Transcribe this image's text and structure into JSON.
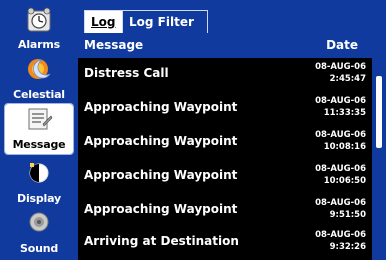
{
  "sidebar": {
    "items": [
      {
        "label": "Alarms",
        "icon": "alarm-clock-icon",
        "selected": false
      },
      {
        "label": "Celestial",
        "icon": "sun-moon-icon",
        "selected": false
      },
      {
        "label": "Message",
        "icon": "message-log-icon",
        "selected": true
      },
      {
        "label": "Display",
        "icon": "display-contrast-icon",
        "selected": false
      },
      {
        "label": "Sound",
        "icon": "speaker-icon",
        "selected": false
      }
    ]
  },
  "tabs": [
    {
      "label": "Log",
      "active": true
    },
    {
      "label": "Log Filter",
      "active": false
    }
  ],
  "table": {
    "columns": {
      "message": "Message",
      "date": "Date"
    },
    "rows": [
      {
        "message": "Distress Call",
        "date": "08-AUG-06",
        "time": "2:45:47"
      },
      {
        "message": "Approaching Waypoint",
        "date": "08-AUG-06",
        "time": "11:33:35"
      },
      {
        "message": "Approaching Waypoint",
        "date": "08-AUG-06",
        "time": "10:08:16"
      },
      {
        "message": "Approaching Waypoint",
        "date": "08-AUG-06",
        "time": "10:06:50"
      },
      {
        "message": "Approaching Waypoint",
        "date": "08-AUG-06",
        "time": "9:51:50"
      },
      {
        "message": "Arriving at Destination",
        "date": "08-AUG-06",
        "time": "9:32:26"
      }
    ]
  },
  "colors": {
    "panel_blue": "#103a9e",
    "list_bg": "#000000",
    "text": "#ffffff"
  }
}
